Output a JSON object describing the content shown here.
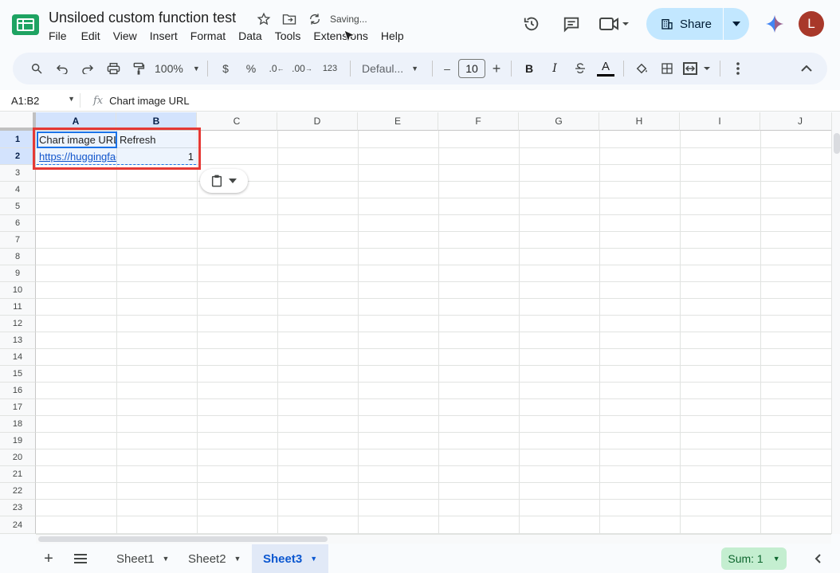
{
  "document": {
    "title": "Unsiloed custom function test",
    "status": "Saving..."
  },
  "menu": [
    "File",
    "Edit",
    "View",
    "Insert",
    "Format",
    "Data",
    "Tools",
    "Extensions",
    "Help"
  ],
  "share": {
    "label": "Share"
  },
  "user": {
    "initial": "L"
  },
  "toolbar": {
    "zoom": "100%",
    "currency": "$",
    "percent": "%",
    "decrease_decimal": ".0",
    "increase_decimal": ".00",
    "number_format": "123",
    "font": "Defaul...",
    "font_size": "10",
    "bold": "B",
    "italic": "I",
    "text_color_label": "A"
  },
  "formula_bar": {
    "name_box": "A1:B2",
    "fx": "fx",
    "value": "Chart image URL"
  },
  "columns": [
    "A",
    "B",
    "C",
    "D",
    "E",
    "F",
    "G",
    "H",
    "I",
    "J"
  ],
  "rows": [
    "1",
    "2",
    "3",
    "4",
    "5",
    "6",
    "7",
    "8",
    "9",
    "10",
    "11",
    "12",
    "13",
    "14",
    "15",
    "16",
    "17",
    "18",
    "19",
    "20",
    "21",
    "22",
    "23",
    "24"
  ],
  "cells": {
    "A1": "Chart image URL",
    "B1": "Refresh",
    "A2": "https://huggingface",
    "B2": "1"
  },
  "sheets": [
    {
      "name": "Sheet1"
    },
    {
      "name": "Sheet2"
    },
    {
      "name": "Sheet3"
    }
  ],
  "active_sheet": "Sheet3",
  "sum": "Sum: 1",
  "colors": {
    "accent": "#0b57d0",
    "selection": "#1a73e8",
    "highlight_box": "#e53935",
    "share_bg": "#c2e7ff",
    "avatar": "#a8382a",
    "sum_bg": "#c4eed0"
  }
}
